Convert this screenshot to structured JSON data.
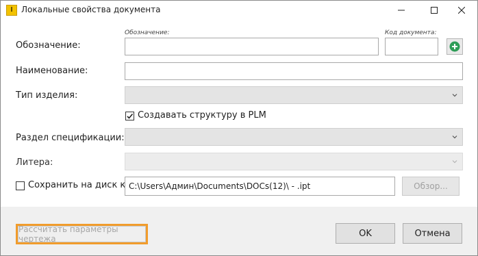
{
  "window": {
    "title": "Локальные свойства документа",
    "app_icon_glyph": "I"
  },
  "form": {
    "designation": {
      "label": "Обозначение:",
      "sublabel": "Обозначение:",
      "value": "",
      "doc_code_sublabel": "Код документа:",
      "doc_code_value": ""
    },
    "name": {
      "label": "Наименование:",
      "value": ""
    },
    "product_type": {
      "label": "Тип изделия:",
      "value": ""
    },
    "create_plm": {
      "label": "Создавать структуру в PLM",
      "checked": true
    },
    "spec_section": {
      "label": "Раздел спецификации:",
      "value": ""
    },
    "litera": {
      "label": "Литера:",
      "value": ""
    },
    "save_to_disk": {
      "label": "Сохранить на диск как:",
      "checked": false,
      "path": "C:\\Users\\Админ\\Documents\\DOCs(12)\\ - .ipt",
      "browse_label": "Обзор..."
    }
  },
  "footer": {
    "calc_label": "Рассчитать параметры чертежа",
    "ok_label": "OK",
    "cancel_label": "Отмена"
  },
  "colors": {
    "highlight": "#f19c2c",
    "add_icon": "#2e9d57"
  },
  "icons": [
    "app-icon",
    "minimize-icon",
    "maximize-icon",
    "close-icon",
    "add-icon",
    "chevron-down-icon",
    "checkmark-icon"
  ]
}
